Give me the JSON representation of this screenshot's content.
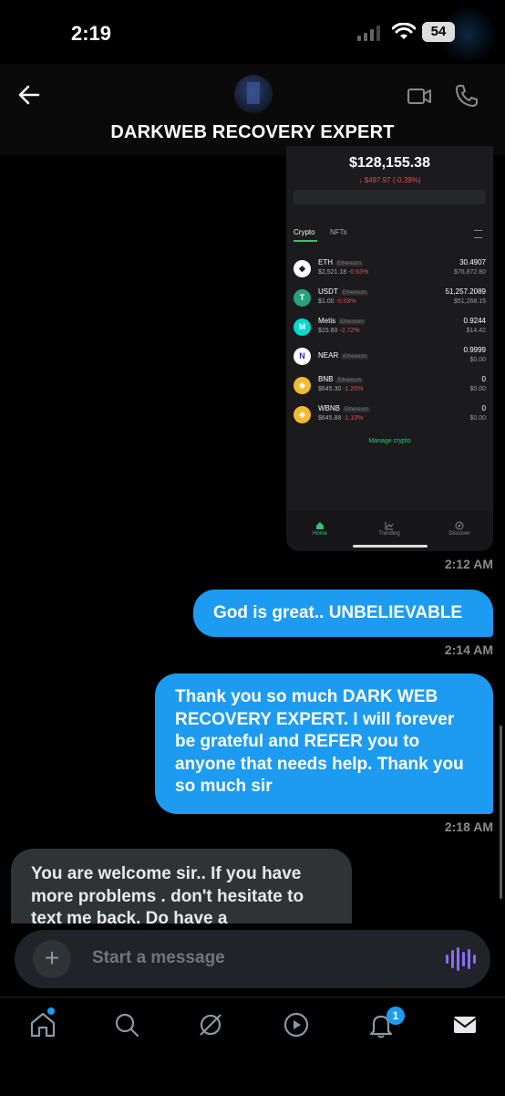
{
  "status": {
    "time": "2:19",
    "battery": "54"
  },
  "header": {
    "title": "DARKWEB RECOVERY EXPERT"
  },
  "screenshot": {
    "balance": "$128,155.38",
    "change": "↓ $497.97 (-0.39%)",
    "tabs": [
      "Crypto",
      "NFTs"
    ],
    "assets": [
      {
        "symbol": "ETH",
        "network": "Ethereum",
        "price": "$2,521.18",
        "pct": "-0.63%",
        "amount": "30.4907",
        "value": "$76,872.80",
        "color": "#ffffff",
        "glyph": "◆"
      },
      {
        "symbol": "USDT",
        "network": "Ethereum",
        "price": "$1.00",
        "pct": "-0.03%",
        "amount": "51,257.2089",
        "value": "$51,268.15",
        "color": "#26a17b",
        "glyph": "T"
      },
      {
        "symbol": "Metis",
        "network": "Ethereum",
        "price": "$15.60",
        "pct": "-2.72%",
        "amount": "0.9244",
        "value": "$14.42",
        "color": "#00dacc",
        "glyph": "M"
      },
      {
        "symbol": "NEAR",
        "network": "Ethereum",
        "price": "",
        "pct": "",
        "amount": "0.9999",
        "value": "$0.00",
        "color": "#ffffff",
        "glyph": "N"
      },
      {
        "symbol": "BNB",
        "network": "Ethereum",
        "price": "$645.30",
        "pct": "-1.20%",
        "amount": "0",
        "value": "$0.00",
        "color": "#f3ba2f",
        "glyph": "◈"
      },
      {
        "symbol": "WBNB",
        "network": "Ethereum",
        "price": "$645.88",
        "pct": "-1.10%",
        "amount": "0",
        "value": "$0.00",
        "color": "#f3ba2f",
        "glyph": "◈"
      }
    ],
    "manage": "Manage crypto",
    "nav": [
      "Home",
      "Trending",
      "Discover"
    ]
  },
  "messages": [
    {
      "time": "2:12 AM"
    },
    {
      "text": "God is great.. UNBELIEVABLE",
      "time": "2:14 AM"
    },
    {
      "text": "Thank you so much DARK WEB RECOVERY EXPERT. I will forever be grateful and REFER you to anyone that needs help. Thank you so much sir",
      "time": "2:18 AM"
    },
    {
      "text": "You are welcome sir.. If you have more problems . don't hesitate to text me back. Do have a"
    }
  ],
  "composer": {
    "placeholder": "Start a message"
  },
  "bottom_nav": {
    "notifications_count": "1"
  }
}
